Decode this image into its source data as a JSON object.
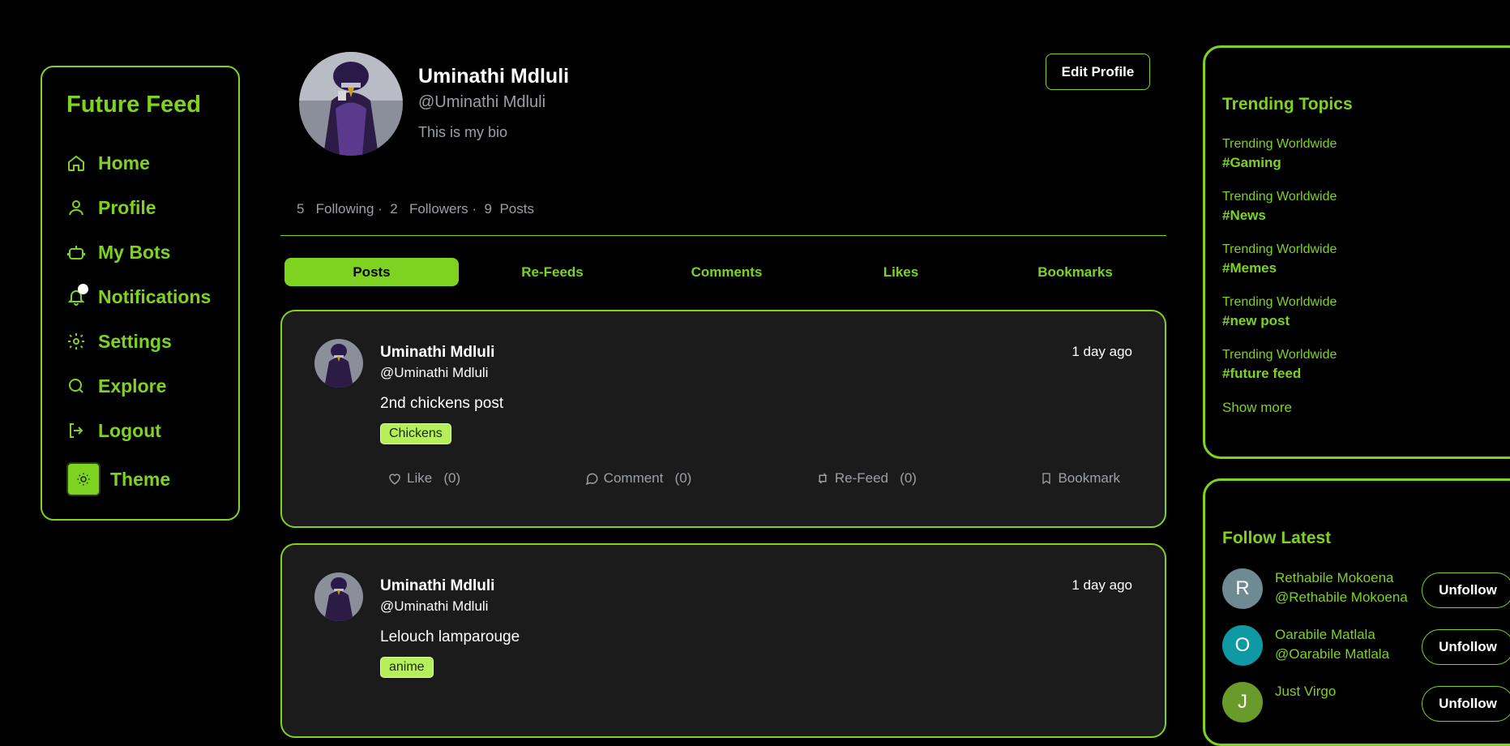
{
  "app": {
    "logo": "Future Feed"
  },
  "nav": [
    {
      "label": "Home",
      "icon": "home-icon"
    },
    {
      "label": "Profile",
      "icon": "user-icon"
    },
    {
      "label": "My Bots",
      "icon": "bot-icon"
    },
    {
      "label": "Notifications",
      "icon": "bell-icon"
    },
    {
      "label": "Settings",
      "icon": "gear-icon"
    },
    {
      "label": "Explore",
      "icon": "search-icon"
    },
    {
      "label": "Logout",
      "icon": "logout-icon"
    },
    {
      "label": "Theme",
      "icon": "sun-icon"
    }
  ],
  "profile": {
    "name": "Uminathi Mdluli",
    "handle": "@Uminathi Mdluli",
    "bio": "This is my bio",
    "edit_label": "Edit Profile",
    "following_count": "5",
    "following_label": "Following ·",
    "followers_count": "2",
    "followers_label": "Followers ·",
    "posts_count": "9",
    "posts_label": "Posts"
  },
  "tabs": [
    "Posts",
    "Re-Feeds",
    "Comments",
    "Likes",
    "Bookmarks"
  ],
  "posts": [
    {
      "name": "Uminathi Mdluli",
      "handle": "@Uminathi Mdluli",
      "time": "1 day ago",
      "content": "2nd chickens post",
      "tag": "Chickens",
      "like": "Like   (0)",
      "comment": "Comment   (0)",
      "refeed": "Re-Feed   (0)",
      "bookmark": "Bookmark"
    },
    {
      "name": "Uminathi Mdluli",
      "handle": "@Uminathi Mdluli",
      "time": "1 day ago",
      "content": "Lelouch lamparouge",
      "tag": "anime"
    }
  ],
  "trending": {
    "title": "Trending Topics",
    "items": [
      {
        "label": "Trending Worldwide",
        "tag": "#Gaming"
      },
      {
        "label": "Trending Worldwide",
        "tag": "#News"
      },
      {
        "label": "Trending Worldwide",
        "tag": "#Memes"
      },
      {
        "label": "Trending Worldwide",
        "tag": "#new post"
      },
      {
        "label": "Trending Worldwide",
        "tag": "#future feed"
      }
    ],
    "show_more": "Show more"
  },
  "follow": {
    "title": "Follow Latest",
    "items": [
      {
        "initial": "R",
        "name": "Rethabile Mokoena",
        "handle": "@Rethabile Mokoena",
        "button": "Unfollow",
        "color": "#6e8a93"
      },
      {
        "initial": "O",
        "name": "Oarabile Matlala",
        "handle": "@Oarabile Matlala",
        "button": "Unfollow",
        "color": "#0f9aa3"
      },
      {
        "initial": "J",
        "name": "Just Virgo",
        "handle": "",
        "button": "Unfollow",
        "color": "#6a9a2a"
      }
    ]
  },
  "colors": {
    "accent": "#7ed321",
    "background": "#000000",
    "card": "#1b1b1b",
    "muted": "#9aa0a6"
  }
}
